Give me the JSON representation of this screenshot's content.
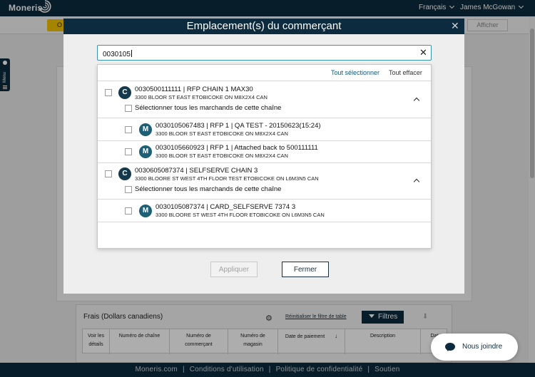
{
  "header": {
    "brand": "Moneris",
    "language": "Français",
    "user": "James McGowan"
  },
  "subbar": {
    "afficher": "Afficher",
    "yellow_btn": "O"
  },
  "side_menu": {
    "label": "Menu"
  },
  "modal": {
    "title": "Emplacement(s) du commerçant",
    "search_value": "0030105",
    "select_all": "Tout sélectionner",
    "clear_all": "Tout effacer",
    "select_chain_label": "Sélectionner tous les marchands de cette chaîne",
    "chain1": {
      "badge": "C",
      "title": "0030500111111 | RFP CHAIN 1 MAX30",
      "address": "3300 BLOOR ST EAST ETOBICOKE ON M8X2X4 CAN"
    },
    "merchant1": {
      "badge": "M",
      "title": "0030105067483 | RFP 1 | QA TEST - 20150623(15:24)",
      "address": "3300 BLOOR ST EAST ETOBICOKE ON M8X2X4 CAN"
    },
    "merchant2": {
      "badge": "M",
      "title": "0030105660923 | RFP 1 | Attached back to 500111111",
      "address": "3300 BLOOR ST EAST ETOBICOKE ON M8X2X4 CAN"
    },
    "chain2": {
      "badge": "C",
      "title": "0030605087374 | SELFSERVE CHAIN 3",
      "address": "3300 BLOORE ST WEST 4TH FLOOR TEST ETOBICOKE ON L6M3N5 CAN"
    },
    "merchant3": {
      "badge": "M",
      "title": "0030105087374 | CARD_SELFSERVE 7374 3",
      "address": "3300 BLOORE ST WEST 4TH FLOOR ETOBICOKE ON L6M3N5 CAN"
    },
    "apply_label": "Appliquer",
    "close_label": "Fermer"
  },
  "frais": {
    "title": "Frais (Dollars canadiens)",
    "reset_filter": "Réinitialiser le filtre de table",
    "filters": "Filtres",
    "columns": {
      "c1a": "Voir les",
      "c1b": "détails",
      "c2": "Numéro de chaîne",
      "c3a": "Numéro de",
      "c3b": "commerçant",
      "c4a": "Numéro de",
      "c4b": "magasin",
      "c5": "Date de paiement",
      "c6": "Description",
      "c7": "Dat"
    }
  },
  "chat": {
    "label": "Nous joindre"
  },
  "footer": {
    "link1": "Moneris.com",
    "link2": "Conditions d'utilisation",
    "link3": "Politique de confidentialité",
    "link4": "Soutien"
  }
}
